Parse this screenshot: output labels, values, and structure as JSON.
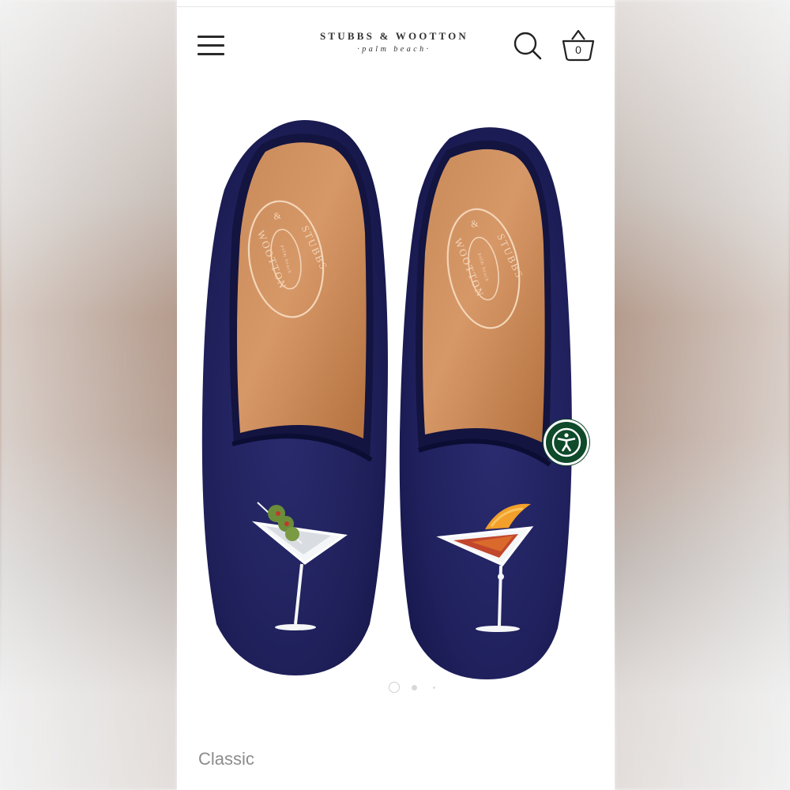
{
  "header": {
    "brand_name": "STUBBS & WOOTTON",
    "brand_tagline": "·palm beach·",
    "basket_count": "0"
  },
  "icons": {
    "menu": "hamburger-menu-icon",
    "search": "search-icon",
    "basket": "basket-icon",
    "accessibility": "accessibility-icon"
  },
  "product": {
    "insole_brand_top": "STUBBS",
    "insole_brand_amp": "&",
    "insole_brand_bottom": "WOOTTON",
    "insole_tagline": "palm beach"
  },
  "carousel": {
    "total": 3,
    "active": 1
  },
  "collection_label": "Classic",
  "colors": {
    "velvet": "#1e1f5a",
    "accessibility_button": "#0f4a2a",
    "label_text": "#8c8c8c"
  }
}
